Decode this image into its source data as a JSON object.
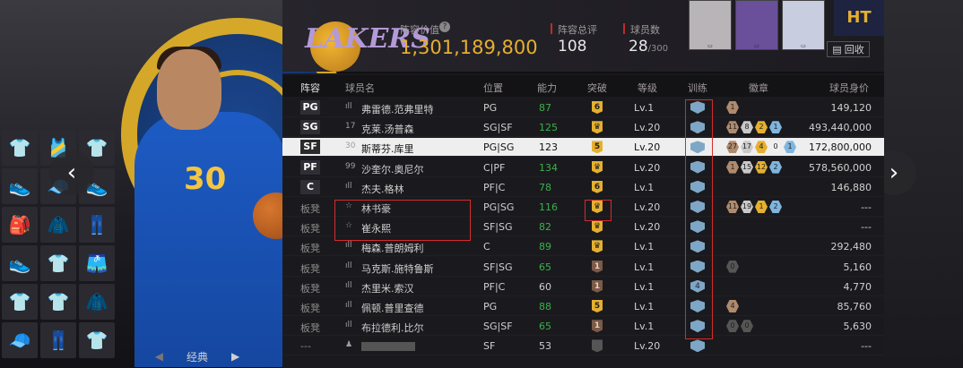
{
  "team": {
    "logo_text": "LAKERS",
    "value_label": "阵容价值",
    "value": "1,301,189,800",
    "rating_label": "阵容总评",
    "rating": "108",
    "count_label": "球员数",
    "count": "28",
    "count_max": "/300",
    "recycle_label": "回收"
  },
  "left": {
    "classic_label": "经典"
  },
  "columns": {
    "lineup": "阵容",
    "name": "球员名",
    "position": "位置",
    "ability": "能力",
    "breakthrough": "突破",
    "level": "等级",
    "training": "训练",
    "badges": "徽章",
    "worth": "球员身价"
  },
  "rows": [
    {
      "slot": "PG",
      "num": "ıll",
      "name": "弗雷德.范弗里特",
      "pos": "PG",
      "ability": "87",
      "ability_color": "green",
      "break": "6",
      "break_style": "gold",
      "level": "Lv.1",
      "train": "",
      "medals": [
        {
          "t": "1",
          "c": "#b08a6c"
        }
      ],
      "worth": "149,120"
    },
    {
      "slot": "SG",
      "num": "17",
      "name": "克莱.汤普森",
      "pos": "SG|SF",
      "ability": "125",
      "ability_color": "green",
      "break": "♛",
      "break_style": "gold",
      "level": "Lv.20",
      "train": "",
      "medals": [
        {
          "t": "11",
          "c": "#b08a6c"
        },
        {
          "t": "8",
          "c": "#c9c9c9"
        },
        {
          "t": "2",
          "c": "#e5b02f"
        },
        {
          "t": "1",
          "c": "#7fb6e0"
        }
      ],
      "worth": "493,440,000"
    },
    {
      "slot": "SF",
      "num": "30",
      "name": "斯蒂芬.库里",
      "pos": "PG|SG",
      "ability": "123",
      "ability_color": "plain",
      "break": "5",
      "break_style": "gold",
      "level": "Lv.20",
      "train": "",
      "medals": [
        {
          "t": "27",
          "c": "#b08a6c"
        },
        {
          "t": "17",
          "c": "#c9c9c9"
        },
        {
          "t": "4",
          "c": "#e5b02f"
        },
        {
          "t": "0",
          "c": "#f0f0f0"
        },
        {
          "t": "1",
          "c": "#7fb6e0"
        }
      ],
      "worth": "172,800,000",
      "selected": true
    },
    {
      "slot": "PF",
      "num": "99",
      "name": "沙奎尔.奥尼尔",
      "pos": "C|PF",
      "ability": "134",
      "ability_color": "green",
      "break": "♛",
      "break_style": "gold",
      "level": "Lv.20",
      "train": "",
      "medals": [
        {
          "t": "1",
          "c": "#b08a6c"
        },
        {
          "t": "15",
          "c": "#c9c9c9"
        },
        {
          "t": "12",
          "c": "#e5b02f"
        },
        {
          "t": "2",
          "c": "#7fb6e0"
        }
      ],
      "worth": "578,560,000"
    },
    {
      "slot": "C",
      "num": "ıll",
      "name": "杰夫.格林",
      "pos": "PF|C",
      "ability": "78",
      "ability_color": "green",
      "break": "6",
      "break_style": "gold",
      "level": "Lv.1",
      "train": "",
      "medals": [],
      "worth": "146,880"
    },
    {
      "slot": "板凳",
      "num": "☆",
      "name": "林书豪",
      "pos": "PG|SG",
      "ability": "116",
      "ability_color": "green",
      "break": "♛",
      "break_style": "gold",
      "level": "Lv.20",
      "train": "",
      "medals": [
        {
          "t": "11",
          "c": "#b08a6c"
        },
        {
          "t": "19",
          "c": "#c9c9c9"
        },
        {
          "t": "1",
          "c": "#e5b02f"
        },
        {
          "t": "2",
          "c": "#7fb6e0"
        }
      ],
      "worth": "---"
    },
    {
      "slot": "板凳",
      "num": "☆",
      "name": "崔永熙",
      "pos": "SF|SG",
      "ability": "82",
      "ability_color": "green",
      "break": "♛",
      "break_style": "gold",
      "level": "Lv.20",
      "train": "",
      "medals": [],
      "worth": "---"
    },
    {
      "slot": "板凳",
      "num": "ıll",
      "name": "梅森.普朗姆利",
      "pos": "C",
      "ability": "89",
      "ability_color": "green",
      "break": "♛",
      "break_style": "gold",
      "level": "Lv.1",
      "train": "",
      "medals": [],
      "worth": "292,480"
    },
    {
      "slot": "板凳",
      "num": "ıll",
      "name": "马克斯.施特鲁斯",
      "pos": "SF|SG",
      "ability": "65",
      "ability_color": "green",
      "break": "1",
      "break_style": "brown",
      "level": "Lv.1",
      "train": "",
      "medals": [
        {
          "t": "0",
          "c": "#555"
        }
      ],
      "worth": "5,160"
    },
    {
      "slot": "板凳",
      "num": "ıll",
      "name": "杰里米.索汉",
      "pos": "PF|C",
      "ability": "60",
      "ability_color": "plain",
      "break": "1",
      "break_style": "brown",
      "level": "Lv.1",
      "train": "4",
      "medals": [],
      "worth": "4,770"
    },
    {
      "slot": "板凳",
      "num": "ıll",
      "name": "佩顿.普里查德",
      "pos": "PG",
      "ability": "88",
      "ability_color": "green",
      "break": "5",
      "break_style": "gold",
      "level": "Lv.1",
      "train": "",
      "medals": [
        {
          "t": "4",
          "c": "#b08a6c"
        }
      ],
      "worth": "85,760"
    },
    {
      "slot": "板凳",
      "num": "ıll",
      "name": "布拉德利.比尔",
      "pos": "SG|SF",
      "ability": "65",
      "ability_color": "green",
      "break": "1",
      "break_style": "brown",
      "level": "Lv.1",
      "train": "",
      "medals": [
        {
          "t": "0",
          "c": "#555"
        },
        {
          "t": "0",
          "c": "#555"
        }
      ],
      "worth": "5,630"
    },
    {
      "slot": "---",
      "num": "♟",
      "name": "",
      "pos": "SF",
      "ability": "53",
      "ability_color": "plain",
      "break": "",
      "break_style": "grey",
      "level": "Lv.20",
      "train": "",
      "medals": [],
      "worth": "---"
    }
  ],
  "colors": {
    "accent_gold": "#e5b02f",
    "ability_green": "#3cb04a",
    "highlight_red": "#d62a2a"
  }
}
